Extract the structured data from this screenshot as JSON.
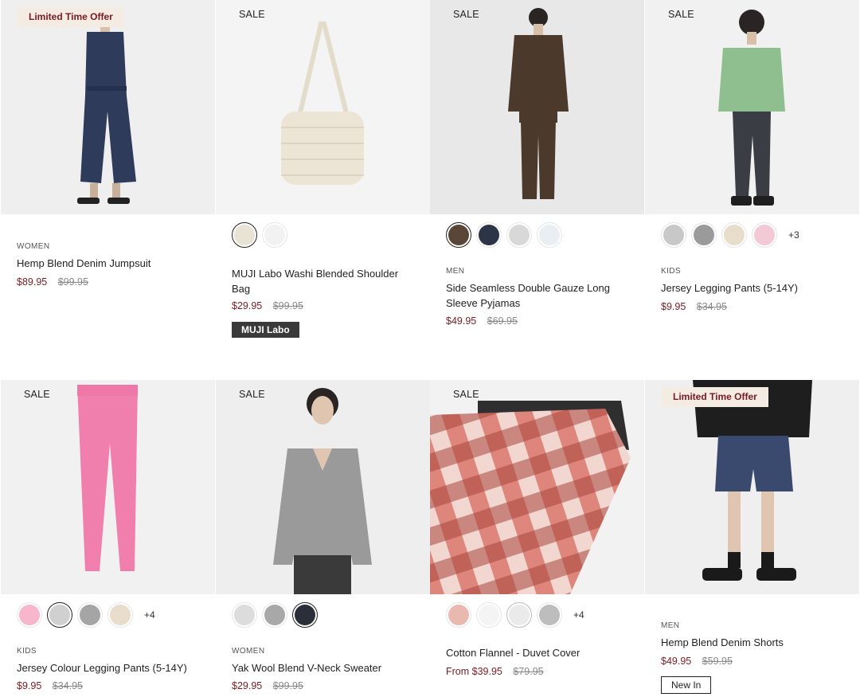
{
  "products": [
    {
      "badge": "Limited Time Offer",
      "category": "WOMEN",
      "name": "Hemp Blend Denim Jumpsuit",
      "price": "$89.95",
      "was": "$99.95",
      "image": "denim-jumpsuit-photo"
    },
    {
      "badge": "SALE",
      "category": "",
      "name": "MUJI Labo Washi Blended Shoulder Bag",
      "price": "$29.95",
      "was": "$99.95",
      "tag": "MUJI Labo",
      "image": "shoulder-bag-photo",
      "swatches": [
        "#e9e3d6",
        "#f2f2f2"
      ]
    },
    {
      "badge": "SALE",
      "category": "MEN",
      "name": "Side Seamless Double Gauze Long Sleeve Pyjamas",
      "price": "$49.95",
      "was": "$69.95",
      "image": "pyjamas-photo",
      "swatches": [
        "#5a4636",
        "#2c3447",
        "#d8d8d8",
        "#e8eef2"
      ]
    },
    {
      "badge": "SALE",
      "category": "KIDS",
      "name": "Jersey Legging Pants (5-14Y)",
      "price": "$9.95",
      "was": "$34.95",
      "image": "kids-legging-photo",
      "swatches": [
        "#c8c8c8",
        "#9a9a9a",
        "#e8dccb",
        "#f4c9d6"
      ],
      "more": "+3"
    },
    {
      "badge": "SALE",
      "category": "KIDS",
      "name": "Jersey Colour Legging Pants (5-14Y)",
      "price": "$9.95",
      "was": "$34.95",
      "image": "pink-legging-photo",
      "swatches": [
        "#f7b6cc",
        "#d0d0d0",
        "#a5a5a5",
        "#e8dccb"
      ],
      "more": "+4"
    },
    {
      "badge": "SALE",
      "category": "WOMEN",
      "name": "Yak Wool Blend V-Neck Sweater",
      "price": "$29.95",
      "was": "$99.95",
      "image": "sweater-photo",
      "swatches": [
        "#dcdcdc",
        "#a8a8a8",
        "#2b2f3a"
      ]
    },
    {
      "badge": "SALE",
      "category": "",
      "name": "Cotton Flannel - Duvet Cover",
      "price": "From $39.95",
      "was": "$79.95",
      "image": "duvet-photo",
      "swatches": [
        "#e9b9b0",
        "#f4f4f4",
        "#eaeaea",
        "#bdbdbd"
      ],
      "more": "+4"
    },
    {
      "badge": "Limited Time Offer",
      "category": "MEN",
      "name": "Hemp Blend Denim Shorts",
      "price": "$49.95",
      "was": "$59.95",
      "tag": "New In",
      "image": "denim-shorts-photo"
    }
  ]
}
